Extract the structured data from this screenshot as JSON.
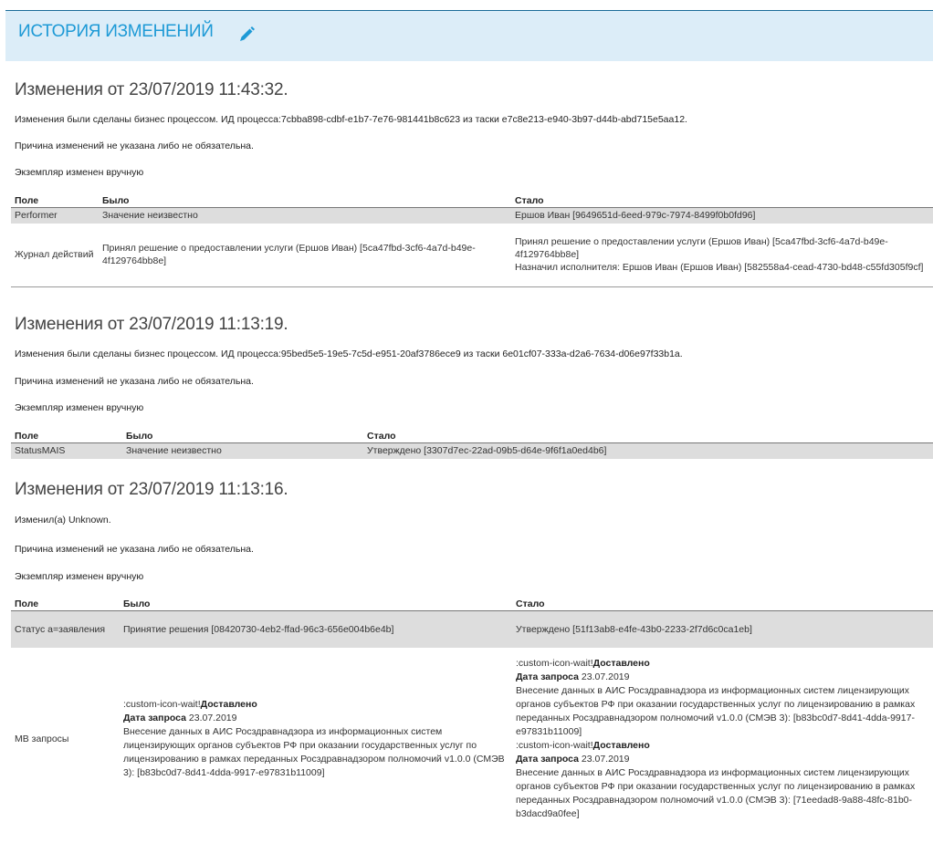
{
  "header": {
    "title": "ИСТОРИЯ ИЗМЕНЕНИЙ",
    "icon": "pencil-icon",
    "accent": "#1e9ad6"
  },
  "columns": {
    "field": "Поле",
    "was": "Было",
    "became": "Стало"
  },
  "sections": [
    {
      "title": "Изменения от 23/07/2019 11:43:32.",
      "who": "Изменения были сделаны бизнес процессом. ИД процесса:7cbba898-cdbf-e1b7-7e76-981441b8c623 из таски e7c8e213-e940-3b97-d44b-abd715e5aa12.",
      "reason": "Причина изменений не указана либо не обязательна.",
      "mode": "Экземпляр изменен вручную",
      "rows": [
        {
          "field": "Performer",
          "was": "Значение неизвестно",
          "became": "Ершов Иван [9649651d-6eed-979c-7974-8499f0b0fd96]"
        },
        {
          "field": "Журнал действий",
          "was": "Принял решение о предоставлении услуги (Ершов Иван) [5ca47fbd-3cf6-4a7d-b49e-4f129764bb8e]",
          "became_1": "Принял решение о предоставлении услуги (Ершов Иван) [5ca47fbd-3cf6-4a7d-b49e-4f129764bb8e]",
          "became_2": "Назначил исполнителя: Ершов Иван (Ершов Иван) [582558a4-cead-4730-bd48-c55fd305f9cf]"
        }
      ]
    },
    {
      "title": "Изменения от 23/07/2019 11:13:19.",
      "who": "Изменения были сделаны бизнес процессом. ИД процесса:95bed5e5-19e5-7c5d-e951-20af3786ece9 из таски 6e01cf07-333a-d2a6-7634-d06e97f33b1a.",
      "reason": "Причина изменений не указана либо не обязательна.",
      "mode": "Экземпляр изменен вручную",
      "rows": [
        {
          "field": "StatusMAIS",
          "was": "Значение неизвестно",
          "became": "Утверждено [3307d7ec-22ad-09b5-d64e-9f6f1a0ed4b6]"
        }
      ]
    },
    {
      "title": "Изменения от 23/07/2019 11:13:16.",
      "who": "Изменил(а) Unknown.",
      "reason": "Причина изменений не указана либо не обязательна.",
      "mode": "Экземпляр изменен вручную",
      "rows": [
        {
          "field": "Статус а=заявления",
          "was": "Принятие решения [08420730-4eb2-ffad-96c3-656e004b6e4b]",
          "became": "Утверждено [51f13ab8-e4fe-43b0-2233-2f7d6c0ca1eb]"
        },
        {
          "field": "МВ запросы",
          "was": {
            "prefix": ":custom-icon-wait!",
            "status": "Доставлено",
            "date_label": "Дата запроса",
            "date": "23.07.2019",
            "text": "Внесение данных в АИС Росздравнадзора из информационных систем лицензирующих органов субъектов РФ при оказании государственных услуг по лицензированию в рамках переданных Росздравнадзором полномочий v1.0.0 (СМЭВ 3): [b83bc0d7-8d41-4dda-9917-e97831b11009]"
          },
          "became_1": {
            "prefix": ":custom-icon-wait!",
            "status": "Доставлено",
            "date_label": "Дата запроса",
            "date": "23.07.2019",
            "text": "Внесение данных в АИС Росздравнадзора из информационных систем лицензирующих органов субъектов РФ при оказании государственных услуг по лицензированию в рамках переданных Росздравнадзором полномочий v1.0.0 (СМЭВ 3): [b83bc0d7-8d41-4dda-9917-e97831b11009]"
          },
          "became_2": {
            "prefix": ":custom-icon-wait!",
            "status": "Доставлено",
            "date_label": "Дата запроса",
            "date": "23.07.2019",
            "text": "Внесение данных в АИС Росздравнадзора из информационных систем лицензирующих органов субъектов РФ при оказании государственных услуг по лицензированию в рамках переданных Росздравнадзором полномочий v1.0.0 (СМЭВ 3): [71eedad8-9a88-48fc-81b0-b3dacd9a0fee]"
          }
        }
      ]
    }
  ]
}
